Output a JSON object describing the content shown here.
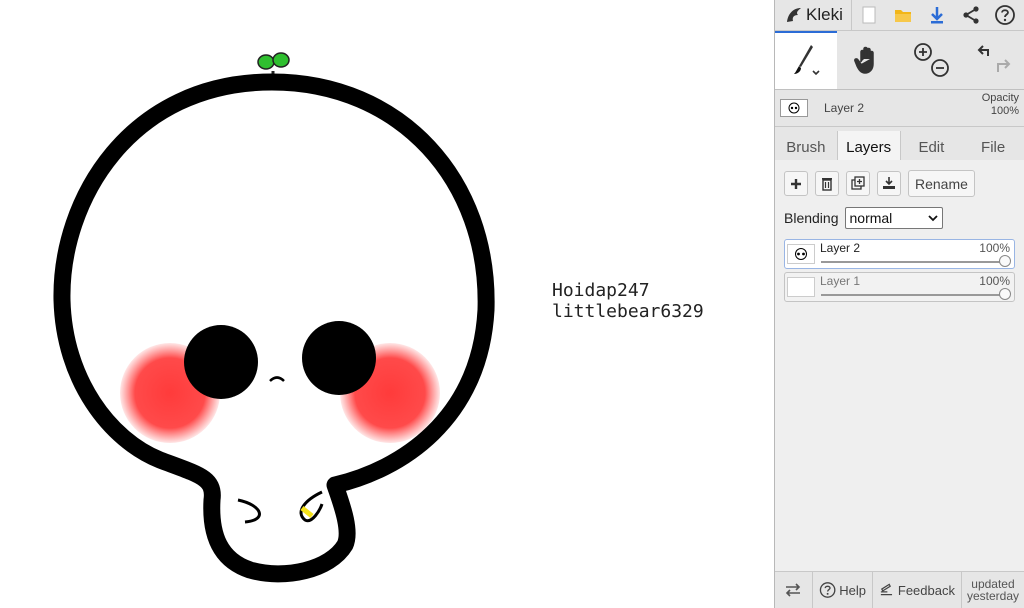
{
  "app": {
    "name": "Kleki"
  },
  "canvas": {
    "text_lines": [
      "Hoidap247",
      "littlebear6329"
    ]
  },
  "toolbar": {
    "icons": [
      "new-file-icon",
      "open-folder-icon",
      "download-icon",
      "share-icon",
      "help-icon"
    ],
    "accent_color": "#2b6cd6"
  },
  "tools": [
    "brush-tool",
    "hand-tool",
    "zoom-tool",
    "undo-redo"
  ],
  "active_layer": {
    "name": "Layer 2",
    "opacity_label": "Opacity",
    "opacity_value": "100%"
  },
  "tabs": [
    {
      "label": "Brush",
      "active": false
    },
    {
      "label": "Layers",
      "active": true
    },
    {
      "label": "Edit",
      "active": false
    },
    {
      "label": "File",
      "active": false
    }
  ],
  "layer_actions": {
    "rename_label": "Rename",
    "icons": [
      "add-layer-icon",
      "delete-layer-icon",
      "duplicate-layer-icon",
      "merge-down-icon"
    ]
  },
  "blending": {
    "label": "Blending",
    "value": "normal"
  },
  "layers": [
    {
      "name": "Layer 2",
      "opacity": "100%",
      "selected": true
    },
    {
      "name": "Layer 1",
      "opacity": "100%",
      "selected": false
    }
  ],
  "footer": {
    "help_label": "Help",
    "feedback_label": "Feedback",
    "updated_line1": "updated",
    "updated_line2": "yesterday"
  }
}
